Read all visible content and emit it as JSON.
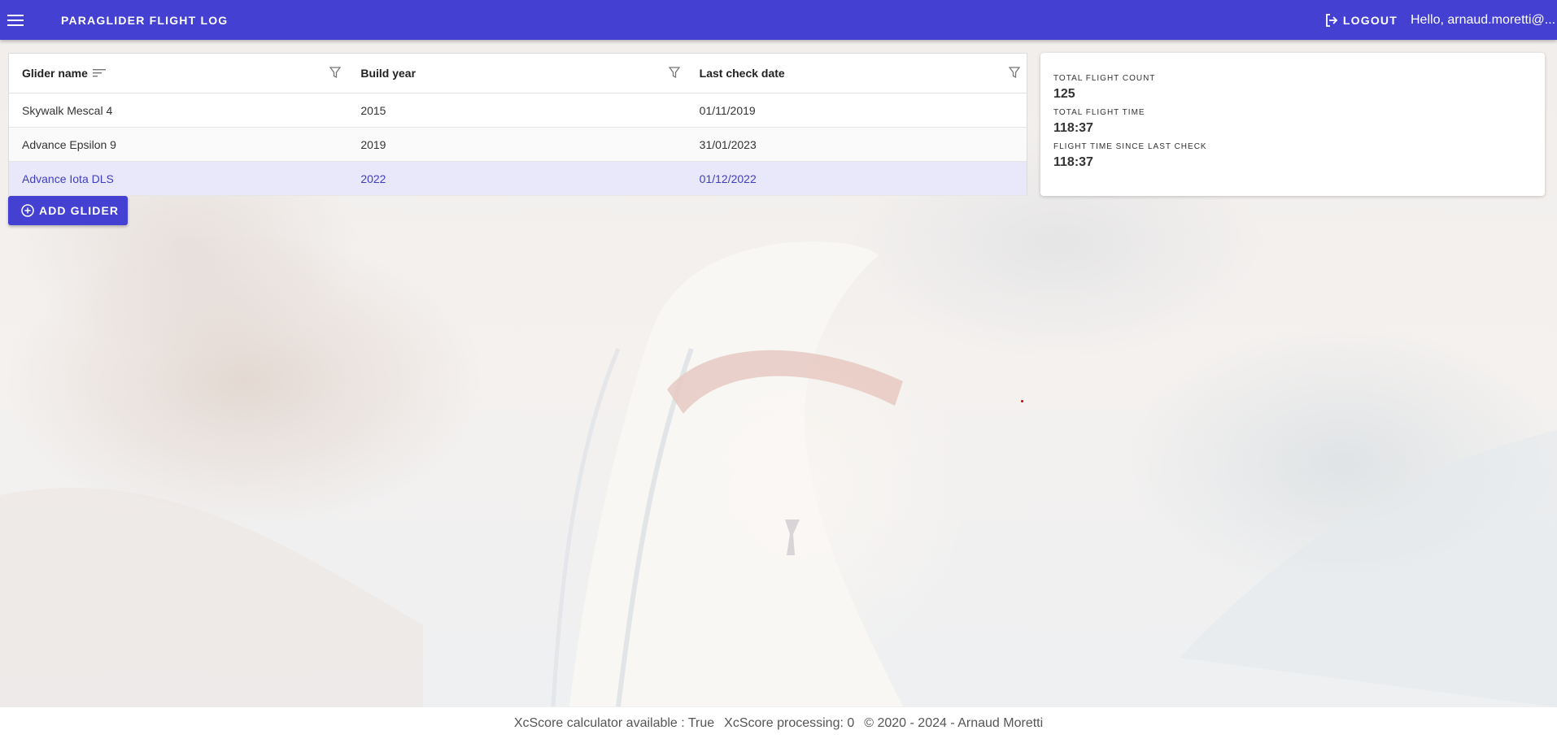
{
  "app": {
    "title": "PARAGLIDER FLIGHT LOG",
    "logout_label": "LOGOUT",
    "greeting": "Hello, arnaud.moretti@..."
  },
  "table": {
    "columns": [
      "Glider name",
      "Build year",
      "Last check date"
    ],
    "rows": [
      {
        "name": "Skywalk Mescal 4",
        "year": "2015",
        "check": "01/11/2019"
      },
      {
        "name": "Advance Epsilon 9",
        "year": "2019",
        "check": "31/01/2023"
      },
      {
        "name": "Advance Iota DLS",
        "year": "2022",
        "check": "01/12/2022"
      }
    ],
    "selected_row_index": 2
  },
  "add_button_label": "ADD GLIDER",
  "stats": [
    {
      "label": "TOTAL FLIGHT COUNT",
      "value": "125"
    },
    {
      "label": "TOTAL FLIGHT TIME",
      "value": "118:37"
    },
    {
      "label": "FLIGHT TIME SINCE LAST CHECK",
      "value": "118:37"
    }
  ],
  "footer": {
    "xcscore_available": "XcScore calculator available : True",
    "xcscore_processing": "XcScore processing: 0",
    "copyright": "© 2020 - 2024 - Arnaud Moretti"
  },
  "colors": {
    "primary": "#4340d2",
    "selected_row_bg": "#e9e8fa",
    "selected_row_text": "#3f3dbf"
  },
  "icons": {
    "menu": "menu-icon",
    "logout": "logout-icon",
    "sort": "sort-icon",
    "filter": "filter-icon",
    "add": "add-circle-icon"
  }
}
